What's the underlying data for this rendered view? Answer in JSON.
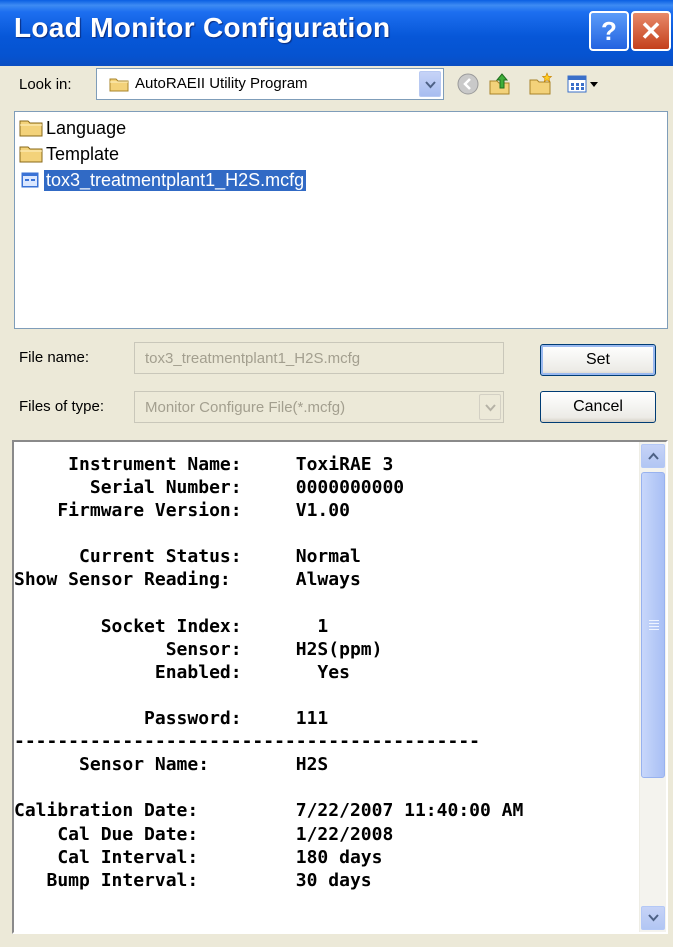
{
  "window": {
    "title": "Load Monitor Configuration",
    "help_label": "?",
    "close_label": "✕"
  },
  "lookin": {
    "label": "Look in:",
    "value": "AutoRAEII Utility Program"
  },
  "files": [
    {
      "name": "Language",
      "type": "folder"
    },
    {
      "name": "Template",
      "type": "folder"
    },
    {
      "name": "tox3_treatmentplant1_H2S.mcfg",
      "type": "file",
      "selected": true
    }
  ],
  "filename": {
    "label": "File name:",
    "value": "tox3_treatmentplant1_H2S.mcfg"
  },
  "filetype": {
    "label": "Files of type:",
    "value": "Monitor Configure File(*.mcfg)"
  },
  "buttons": {
    "set": "Set",
    "cancel": "Cancel"
  },
  "info_lines": [
    "     Instrument Name:     ToxiRAE 3",
    "       Serial Number:     0000000000",
    "    Firmware Version:     V1.00",
    "",
    "      Current Status:     Normal",
    "Show Sensor Reading:      Always",
    "",
    "        Socket Index:       1",
    "              Sensor:     H2S(ppm)",
    "             Enabled:       Yes",
    "",
    "            Password:     111",
    "-------------------------------------------",
    "      Sensor Name:        H2S",
    "",
    "Calibration Date:         7/22/2007 11:40:00 AM",
    "    Cal Due Date:         1/22/2008",
    "    Cal Interval:         180 days",
    "   Bump Interval:         30 days"
  ],
  "colors": {
    "title_bar": "#0757d8",
    "selection": "#316ac5",
    "dialog_bg": "#ece9d8"
  }
}
